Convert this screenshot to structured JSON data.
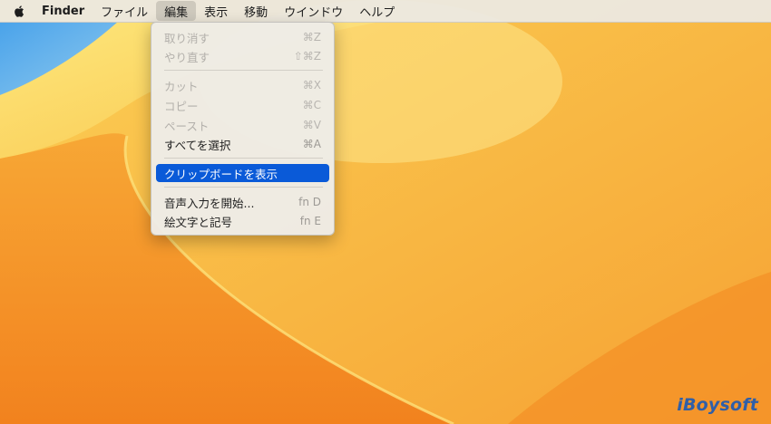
{
  "menubar": {
    "apple_icon": "apple-icon",
    "app_name": "Finder",
    "items": [
      "ファイル",
      "編集",
      "表示",
      "移動",
      "ウインドウ",
      "ヘルプ"
    ],
    "active_item": "編集"
  },
  "edit_menu": {
    "items": [
      {
        "label": "取り消す",
        "shortcut": "⌘Z",
        "enabled": false
      },
      {
        "label": "やり直す",
        "shortcut": "⇧⌘Z",
        "enabled": false
      },
      {
        "label": "カット",
        "shortcut": "⌘X",
        "enabled": false
      },
      {
        "label": "コピー",
        "shortcut": "⌘C",
        "enabled": false
      },
      {
        "label": "ペースト",
        "shortcut": "⌘V",
        "enabled": false
      },
      {
        "label": "すべてを選択",
        "shortcut": "⌘A",
        "enabled": true
      },
      {
        "label": "クリップボードを表示",
        "shortcut": "",
        "enabled": true,
        "highlighted": true
      },
      {
        "label": "音声入力を開始...",
        "shortcut": "fn D",
        "enabled": true
      },
      {
        "label": "絵文字と記号",
        "shortcut": "fn E",
        "enabled": true
      }
    ]
  },
  "colors": {
    "highlight": "#0a5ad8",
    "wallpaper_orange": "#f8992a",
    "wallpaper_blue": "#5aa8e8"
  },
  "watermark": "iBoysoft"
}
